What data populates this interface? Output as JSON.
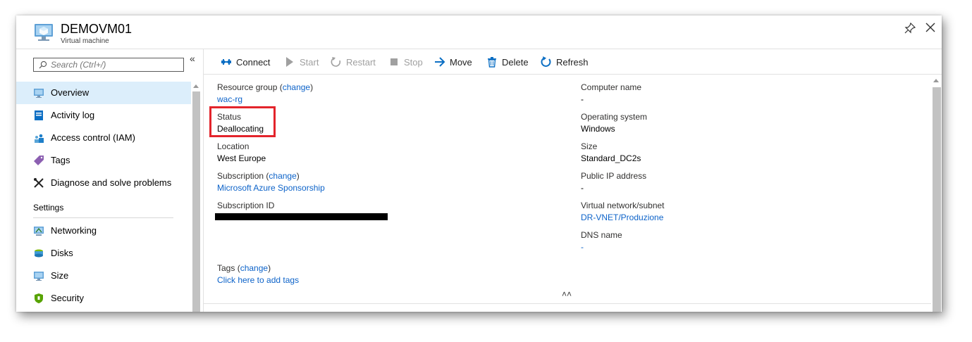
{
  "header": {
    "title": "DEMOVM01",
    "subtitle": "Virtual machine"
  },
  "sidebar": {
    "search_placeholder": "Search (Ctrl+/)",
    "collapse_glyph": "«",
    "items": [
      {
        "label": "Overview",
        "icon": "overview-icon"
      },
      {
        "label": "Activity log",
        "icon": "activity-log-icon"
      },
      {
        "label": "Access control (IAM)",
        "icon": "iam-icon"
      },
      {
        "label": "Tags",
        "icon": "tag-icon"
      },
      {
        "label": "Diagnose and solve problems",
        "icon": "wrench-icon"
      }
    ],
    "section_settings": "Settings",
    "settings_items": [
      {
        "label": "Networking",
        "icon": "networking-icon"
      },
      {
        "label": "Disks",
        "icon": "disks-icon"
      },
      {
        "label": "Size",
        "icon": "size-icon"
      },
      {
        "label": "Security",
        "icon": "security-icon"
      }
    ]
  },
  "toolbar": {
    "connect": "Connect",
    "start": "Start",
    "restart": "Restart",
    "stop": "Stop",
    "move": "Move",
    "delete": "Delete",
    "refresh": "Refresh"
  },
  "essentials": {
    "resource_group_label": "Resource group",
    "change": "change",
    "resource_group_value": "wac-rg",
    "status_label": "Status",
    "status_value": "Deallocating",
    "location_label": "Location",
    "location_value": "West Europe",
    "subscription_label": "Subscription",
    "subscription_value": "Microsoft Azure Sponsorship",
    "subscription_id_label": "Subscription ID",
    "computer_name_label": "Computer name",
    "computer_name_value": "-",
    "os_label": "Operating system",
    "os_value": "Windows",
    "size_label": "Size",
    "size_value": "Standard_DC2s",
    "public_ip_label": "Public IP address",
    "public_ip_value": "-",
    "vnet_label": "Virtual network/subnet",
    "vnet_value": "DR-VNET/Produzione",
    "dns_label": "DNS name",
    "dns_value": "-",
    "tags_label": "Tags",
    "tags_value": "Click here to add tags"
  },
  "colors": {
    "accent": "#0d63c9",
    "active_nav": "#dceefb",
    "highlight_box": "#e3242b"
  }
}
